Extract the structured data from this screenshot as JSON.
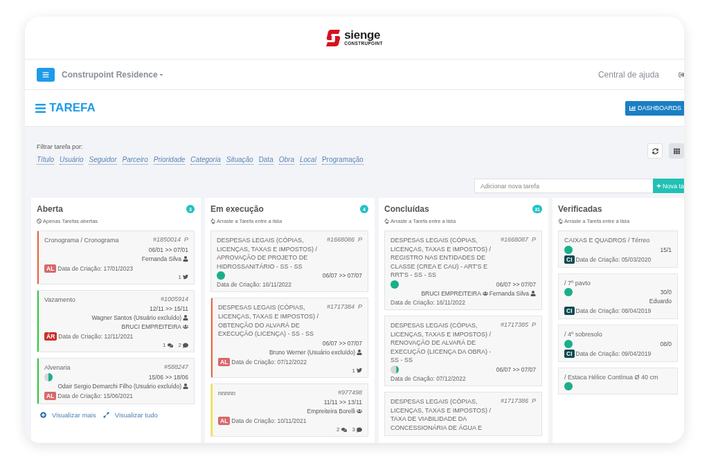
{
  "logo": {
    "name": "sienge",
    "tagline": "CONSTRUPOINT"
  },
  "navbar": {
    "project": "Construpoint Residence",
    "help": "Central de ajuda"
  },
  "page": {
    "title": "TAREFA",
    "dashboard_button": "DASHBOARDS"
  },
  "filters": {
    "label": "Filtrar tarefa por:",
    "items": [
      {
        "label": "Título",
        "italic": true
      },
      {
        "label": "Usuário",
        "italic": true
      },
      {
        "label": "Seguidor",
        "italic": true
      },
      {
        "label": "Parceiro",
        "italic": true
      },
      {
        "label": "Prioridade",
        "italic": true
      },
      {
        "label": "Categoria",
        "italic": true
      },
      {
        "label": "Situação",
        "italic": true
      },
      {
        "label": "Data",
        "italic": false
      },
      {
        "label": "Obra",
        "italic": true
      },
      {
        "label": "Local",
        "italic": true
      },
      {
        "label": "Programação",
        "italic": false
      }
    ]
  },
  "new_task": {
    "placeholder": "Adicionar nova tarefa",
    "button": "Nova ta"
  },
  "columns": [
    {
      "title": "Aberta",
      "count": "3",
      "hint": "Apenas Tarefas abertas",
      "kind": "ban",
      "cards": [
        {
          "title": "Cronograma / Cronograma",
          "id": "#1850014",
          "priority": "P",
          "color": "#f0643c",
          "dates": "06/01 >> 07/01",
          "people": [
            [
              {
                "name": "Fernanda Silva",
                "kind": "user"
              }
            ]
          ],
          "badge": {
            "text": "AL",
            "color": "#d9686a"
          },
          "created": "Data de Criação: 17/01/2023",
          "counters": [
            {
              "count": "1",
              "kind": "twitter"
            }
          ]
        },
        {
          "title": "Vazamento",
          "id": "#1005914",
          "color": "#2ecc40",
          "dates": "12/11 >> 15/11",
          "people": [
            [
              {
                "name": "Wagner Santos (Usuário excluído)",
                "kind": "user"
              }
            ],
            [
              {
                "name": "BRUCI EMPREITEIRA",
                "kind": "group"
              }
            ]
          ],
          "badge": {
            "text": "ÁR",
            "color": "#c9302c"
          },
          "created": "Data de Criação: 12/11/2021",
          "counters": [
            {
              "count": "1",
              "kind": "comments"
            },
            {
              "count": "2",
              "kind": "comment"
            }
          ]
        },
        {
          "title": "Alvenaria",
          "id": "#588247",
          "color": "#2ecc40",
          "level": 0.5,
          "dates": "15/06 >> 18/06",
          "people": [
            [
              {
                "name": "Odair Sergio Demarchi Filho (Usuário excluído)",
                "kind": "user"
              }
            ]
          ],
          "badge": {
            "text": "AL",
            "color": "#d9686a"
          },
          "created": "Data de Criação: 15/06/2021"
        }
      ],
      "footer": {
        "more": "Visualizar mais",
        "all": "Visualizar tudo"
      }
    },
    {
      "title": "Em execução",
      "count": "4",
      "hint": "Arraste a Tarefa entre a lista",
      "kind": "hand",
      "cards": [
        {
          "title": "DESPESAS LEGAIS (CÓPIAS, LICENÇAS, TAXAS E IMPOSTOS) / APROVAÇÃO DE PROJETO DE HIDROSSANITÁRIO - SS - SS",
          "id": "#1668086",
          "priority": "P",
          "level": 1,
          "dates": "06/07 >> 07/07",
          "created": "Data de Criação: 16/11/2022"
        },
        {
          "title": "DESPESAS LEGAIS (CÓPIAS, LICENÇAS, TAXAS E IMPOSTOS) / OBTENÇÃO DO ALVARÁ DE EXECUÇÃO (LICENÇA) - SS - SS",
          "id": "#1717384",
          "priority": "P",
          "color": "#f0643c",
          "dates": "06/07 >> 07/07",
          "people": [
            [
              {
                "name": "Bruno Werner (Usuário excluído)",
                "kind": "user"
              }
            ]
          ],
          "badge": {
            "text": "AL",
            "color": "#d9686a"
          },
          "created": "Data de Criação: 07/12/2022",
          "counters": [
            {
              "count": "1",
              "kind": "twitter"
            }
          ]
        },
        {
          "title": "nnnnn",
          "id": "#977498",
          "color": "#f5e61c",
          "dates": "11/11 >> 13/11",
          "people": [
            [
              {
                "name": "Empreiteira Borelli",
                "kind": "group"
              }
            ]
          ],
          "badge": {
            "text": "AL",
            "color": "#d9686a"
          },
          "created": "Data de Criação: 10/11/2021",
          "counters": [
            {
              "count": "2",
              "kind": "comments"
            },
            {
              "count": "3",
              "kind": "comment"
            }
          ]
        }
      ]
    },
    {
      "title": "Concluídas",
      "count": "31",
      "hint": "Arraste a Tarefa entre a lista",
      "kind": "hand",
      "cards": [
        {
          "title": "DESPESAS LEGAIS (CÓPIAS, LICENÇAS, TAXAS E IMPOSTOS) / REGISTRO NAS ENTIDADES DE CLASSE (CREA E CAU) - ART'S E RRT'S - SS - SS",
          "id": "#1668087",
          "priority": "P",
          "level": 1,
          "dates": "06/07 >> 07/07",
          "people": [
            [
              {
                "name": "BRUCI EMPREITEIRA",
                "kind": "group"
              },
              {
                "name": "Fernanda Silva",
                "kind": "user"
              }
            ]
          ],
          "created": "Data de Criação: 16/11/2022"
        },
        {
          "title": "DESPESAS LEGAIS (CÓPIAS, LICENÇAS, TAXAS E IMPOSTOS) / RENOVAÇÃO DE ALVARÁ DE EXECUÇÃO (LICENÇA DA OBRA) - SS - SS",
          "id": "#1717385",
          "priority": "P",
          "level": 0.3,
          "dates": "06/07 >> 07/07",
          "created": "Data de Criação: 07/12/2022"
        },
        {
          "title": "DESPESAS LEGAIS (CÓPIAS, LICENÇAS, TAXAS E IMPOSTOS) / TAXA DE VIABILIDADE DA CONCESSIONÁRIA DE ÁGUA E",
          "id": "#1717386",
          "priority": "P"
        }
      ]
    },
    {
      "title": "Verificadas",
      "hint": "Arraste a Tarefa entre a lista",
      "kind": "hand",
      "cards": [
        {
          "title": "CAIXAS E QUADROS / Térreo",
          "level": 1,
          "dates": "15/1",
          "badge": {
            "text": "CI",
            "color": "#0e4a50"
          },
          "created": "Data de Criação: 05/03/2020"
        },
        {
          "title": "/ 7º pavto",
          "level": 1,
          "dates": "30/0",
          "people": [
            [
              {
                "name": "Eduardo"
              }
            ]
          ],
          "badge": {
            "text": "CI",
            "color": "#0e4a50"
          },
          "created": "Data de Criação: 08/04/2019"
        },
        {
          "title": "/ 4º sobresolo",
          "level": 1,
          "dates": "08/0",
          "badge": {
            "text": "CI",
            "color": "#0e4a50"
          },
          "created": "Data de Criação: 09/04/2019"
        },
        {
          "title": "/ Estaca Hélice Contínua Ø 40 cm",
          "level": 1
        }
      ]
    }
  ]
}
